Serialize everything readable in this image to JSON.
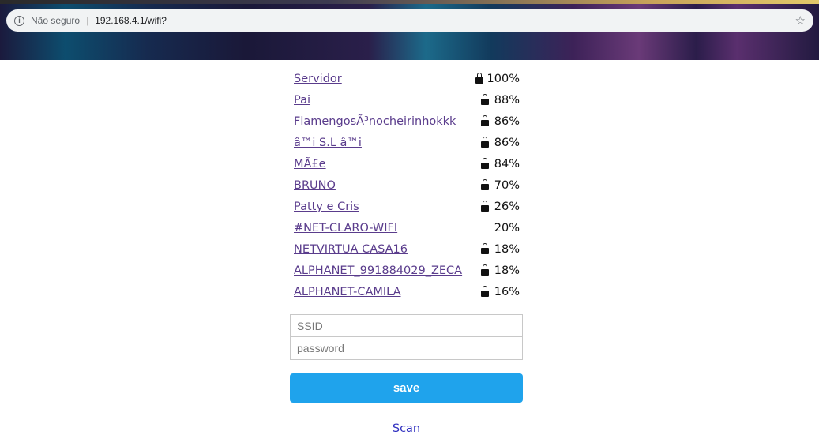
{
  "browser": {
    "security_label": "Não seguro",
    "url": "192.168.4.1/wifi?"
  },
  "networks": [
    {
      "ssid": "Servidor",
      "secured": true,
      "quality": "100%"
    },
    {
      "ssid": "Pai",
      "secured": true,
      "quality": "88%"
    },
    {
      "ssid": "FlamengosÃ³nocheirinhokkk",
      "secured": true,
      "quality": "86%"
    },
    {
      "ssid": "â™i S.L â™i",
      "secured": true,
      "quality": "86%"
    },
    {
      "ssid": "MÃ£e",
      "secured": true,
      "quality": "84%"
    },
    {
      "ssid": "BRUNO",
      "secured": true,
      "quality": "70%"
    },
    {
      "ssid": "Patty e Cris",
      "secured": true,
      "quality": "26%"
    },
    {
      "ssid": "#NET-CLARO-WIFI",
      "secured": false,
      "quality": "20%"
    },
    {
      "ssid": "NETVIRTUA CASA16",
      "secured": true,
      "quality": "18%"
    },
    {
      "ssid": "ALPHANET_991884029_ZECA",
      "secured": true,
      "quality": "18%"
    },
    {
      "ssid": "ALPHANET-CAMILA",
      "secured": true,
      "quality": "16%"
    }
  ],
  "form": {
    "ssid_placeholder": "SSID",
    "password_placeholder": "password",
    "save_label": "save"
  },
  "scan_label": "Scan"
}
